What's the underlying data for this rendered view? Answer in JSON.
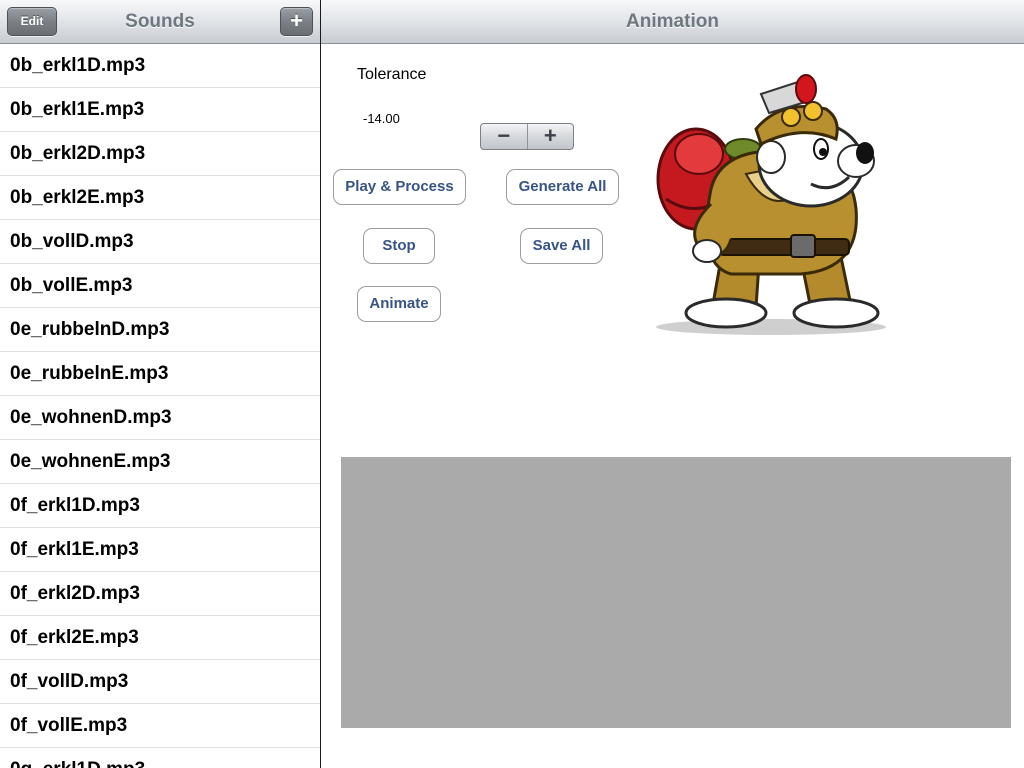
{
  "sidebar": {
    "title": "Sounds",
    "edit_label": "Edit",
    "add_label": "+",
    "items": [
      {
        "label": "0b_erkl1D.mp3"
      },
      {
        "label": "0b_erkl1E.mp3"
      },
      {
        "label": "0b_erkl2D.mp3"
      },
      {
        "label": "0b_erkl2E.mp3"
      },
      {
        "label": "0b_vollD.mp3"
      },
      {
        "label": "0b_vollE.mp3"
      },
      {
        "label": "0e_rubbelnD.mp3"
      },
      {
        "label": "0e_rubbelnE.mp3"
      },
      {
        "label": "0e_wohnenD.mp3"
      },
      {
        "label": "0e_wohnenE.mp3"
      },
      {
        "label": "0f_erkl1D.mp3"
      },
      {
        "label": "0f_erkl1E.mp3"
      },
      {
        "label": "0f_erkl2D.mp3"
      },
      {
        "label": "0f_erkl2E.mp3"
      },
      {
        "label": "0f_vollD.mp3"
      },
      {
        "label": "0f_vollE.mp3"
      },
      {
        "label": "0g_erkl1D.mp3"
      }
    ]
  },
  "detail": {
    "title": "Animation",
    "tolerance_label": "Tolerance",
    "tolerance_value": "-14.00",
    "stepper_minus": "−",
    "stepper_plus": "+",
    "buttons": {
      "play_process": "Play & Process",
      "generate_all": "Generate All",
      "stop": "Stop",
      "save_all": "Save All",
      "animate": "Animate"
    },
    "mascot_icon": "polar-bear-explorer-icon"
  },
  "colors": {
    "button_text": "#385487",
    "canvas_gray": "#aaaaaa",
    "nav_title": "#6f7780"
  }
}
